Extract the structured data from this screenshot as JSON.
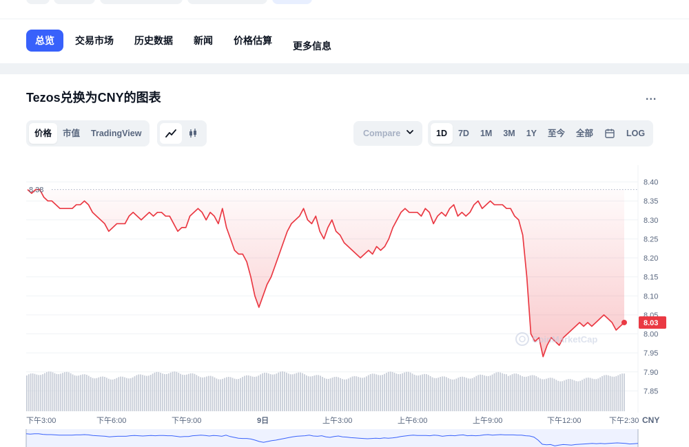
{
  "nav": {
    "tabs": [
      {
        "label": "总览"
      },
      {
        "label": "交易市场"
      },
      {
        "label": "历史数据"
      },
      {
        "label": "新闻"
      },
      {
        "label": "价格估算"
      },
      {
        "label": "更多信息"
      }
    ]
  },
  "chart_section": {
    "title": "Tezos兑换为CNY的图表",
    "more_label": "...",
    "view_tabs": [
      {
        "label": "价格"
      },
      {
        "label": "市值"
      },
      {
        "label": "TradingView"
      }
    ],
    "compare_label": "Compare",
    "ranges": [
      {
        "label": "1D"
      },
      {
        "label": "7D"
      },
      {
        "label": "1M"
      },
      {
        "label": "3M"
      },
      {
        "label": "1Y"
      },
      {
        "label": "至今"
      },
      {
        "label": "全部"
      }
    ],
    "log_label": "LOG",
    "watermark": "CoinMarketCap",
    "accent_color": "#3861fb",
    "line_color": "#ea3943"
  },
  "chart_data": {
    "type": "line",
    "ylim": [
      7.8,
      8.43
    ],
    "y_ticks": [
      "8.40",
      "8.35",
      "8.30",
      "8.25",
      "8.20",
      "8.15",
      "8.10",
      "8.05",
      "8.00",
      "7.95",
      "7.90",
      "7.85"
    ],
    "x_ticks": [
      "下午3:00",
      "下午6:00",
      "下午9:00",
      "9日",
      "上午3:00",
      "上午6:00",
      "上午9:00",
      "下午12:00",
      "下午2:30"
    ],
    "x_unit": "CNY",
    "open_label": "8.38",
    "open_price": 8.38,
    "last_label": "8.03",
    "last_price": 8.03,
    "series": [
      {
        "values": [
          8.38,
          8.37,
          8.38,
          8.38,
          8.36,
          8.35,
          8.35,
          8.34,
          8.33,
          8.33,
          8.33,
          8.33,
          8.34,
          8.34,
          8.35,
          8.34,
          8.32,
          8.31,
          8.3,
          8.29,
          8.27,
          8.28,
          8.29,
          8.29,
          8.29,
          8.31,
          8.32,
          8.31,
          8.3,
          8.31,
          8.32,
          8.31,
          8.32,
          8.32,
          8.31,
          8.31,
          8.29,
          8.27,
          8.28,
          8.28,
          8.31,
          8.32,
          8.33,
          8.32,
          8.3,
          8.32,
          8.31,
          8.29,
          8.33,
          8.28,
          8.25,
          8.22,
          8.21,
          8.21,
          8.19,
          8.15,
          8.1,
          8.07,
          8.1,
          8.13,
          8.15,
          8.18,
          8.21,
          8.24,
          8.27,
          8.29,
          8.3,
          8.31,
          8.33,
          8.3,
          8.29,
          8.31,
          8.27,
          8.25,
          8.28,
          8.3,
          8.27,
          8.26,
          8.24,
          8.23,
          8.22,
          8.21,
          8.2,
          8.21,
          8.22,
          8.21,
          8.23,
          8.22,
          8.23,
          8.25,
          8.28,
          8.3,
          8.32,
          8.33,
          8.32,
          8.32,
          8.32,
          8.31,
          8.33,
          8.32,
          8.29,
          8.31,
          8.32,
          8.31,
          8.33,
          8.34,
          8.31,
          8.32,
          8.31,
          8.32,
          8.34,
          8.35,
          8.33,
          8.34,
          8.35,
          8.34,
          8.34,
          8.34,
          8.33,
          8.33,
          8.31,
          8.3,
          8.26,
          8.15,
          8.0,
          7.98,
          7.99,
          7.94,
          7.97,
          7.99,
          7.98,
          7.97,
          7.99,
          8.0,
          8.01,
          8.02,
          8.03,
          8.02,
          8.03,
          8.02,
          8.03,
          8.04,
          8.05,
          8.04,
          8.03,
          8.01,
          8.02,
          8.03
        ]
      }
    ],
    "volume_hint": "bars"
  }
}
